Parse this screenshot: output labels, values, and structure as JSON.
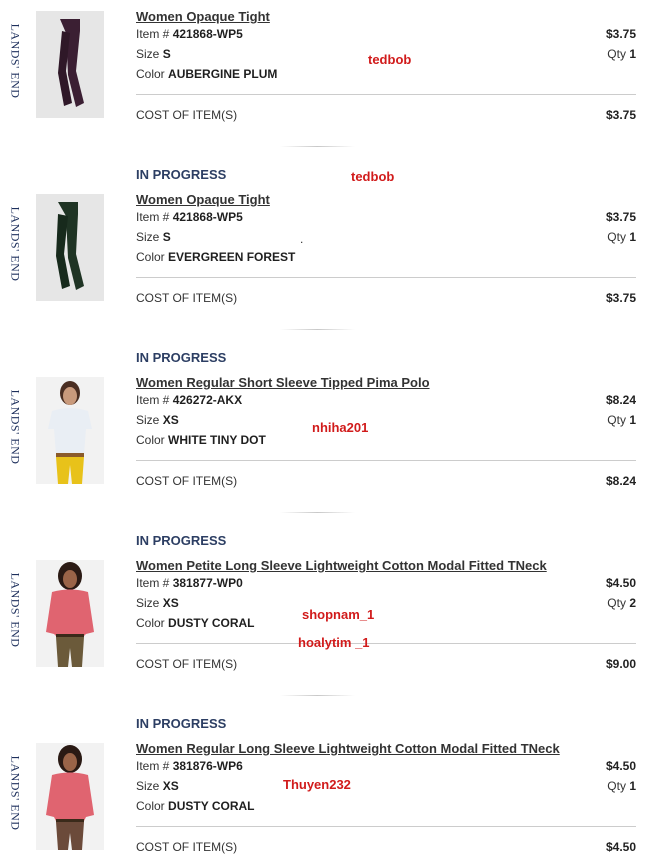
{
  "brand": "LANDS' END",
  "labels": {
    "item_prefix": "Item #",
    "size_prefix": "Size",
    "color_prefix": "Color",
    "qty_prefix": "Qty",
    "cost_label": "COST OF ITEM(S)"
  },
  "items": [
    {
      "status": "",
      "title": "Women Opaque Tight",
      "item_no": "421868-WP5",
      "size": "S",
      "color": "AUBERGINE PLUM",
      "price": "$3.75",
      "qty": "1",
      "cost": "$3.75",
      "image": "tights-plum-image",
      "image_color": "#3b1f33"
    },
    {
      "status": "IN PROGRESS",
      "title": "Women Opaque Tight",
      "item_no": "421868-WP5",
      "size": "S",
      "color": "EVERGREEN FOREST",
      "price": "$3.75",
      "qty": "1",
      "cost": "$3.75",
      "image": "tights-green-image",
      "image_color": "#1f3424"
    },
    {
      "status": "IN PROGRESS",
      "title": "Women Regular Short Sleeve Tipped Pima Polo",
      "item_no": "426272-AKX",
      "size": "XS",
      "color": "WHITE TINY DOT",
      "price": "$8.24",
      "qty": "1",
      "cost": "$8.24",
      "image": "polo-model-image",
      "image_color": "#e9eef4"
    },
    {
      "status": "IN PROGRESS",
      "title": "Women Petite Long Sleeve Lightweight Cotton Modal Fitted TNeck",
      "item_no": "381877-WP0",
      "size": "XS",
      "color": "DUSTY CORAL",
      "price": "$4.50",
      "qty": "2",
      "cost": "$9.00",
      "image": "tneck-model-image",
      "image_color": "#e06470"
    },
    {
      "status": "IN PROGRESS",
      "title": "Women Regular Long Sleeve Lightweight Cotton Modal Fitted TNeck",
      "item_no": "381876-WP6",
      "size": "XS",
      "color": "DUSTY CORAL",
      "price": "$4.50",
      "qty": "1",
      "cost": "$4.50",
      "image": "tneck-model-image",
      "image_color": "#e06470"
    }
  ],
  "annotations": [
    "tedbob",
    "tedbob",
    "nhiha201",
    "shopnam_1",
    "hoalytim _1",
    "Thuyen232"
  ],
  "stray_mark": ".",
  "colors": {
    "status_text": "#2c3e63",
    "annotation_red": "#d11b1b",
    "brand_navy": "#1d2f5c"
  }
}
